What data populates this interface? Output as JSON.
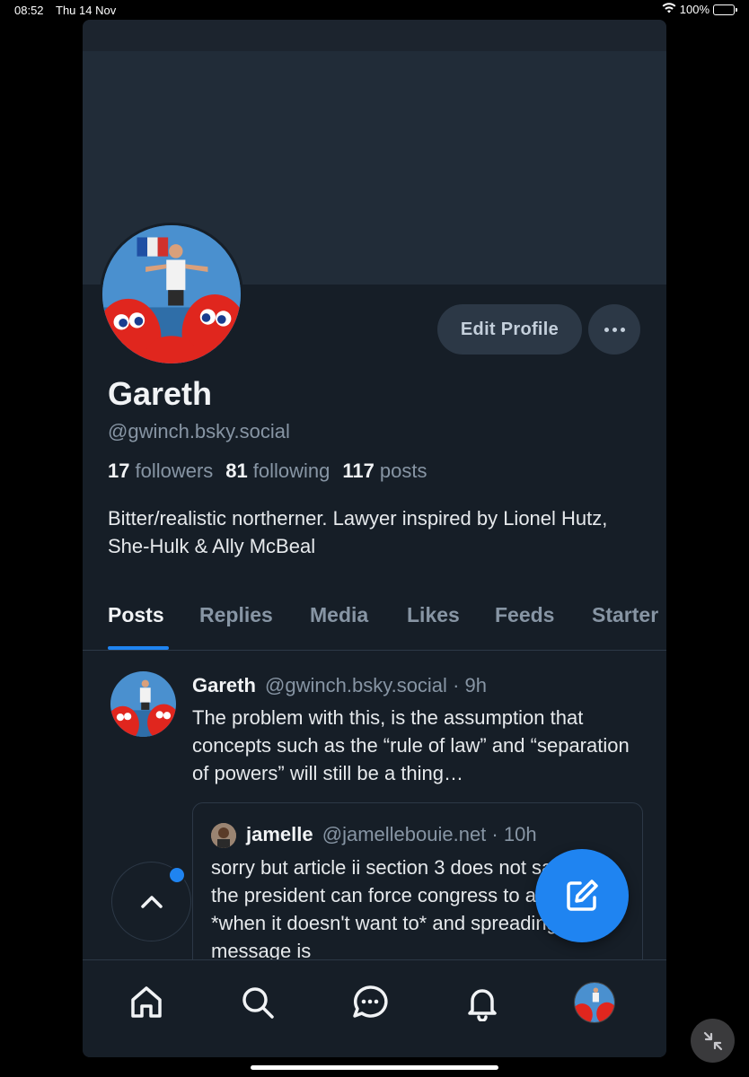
{
  "status_bar": {
    "time": "08:52",
    "date": "Thu 14 Nov",
    "battery": "100%",
    "icons": [
      "wifi-icon",
      "battery-charging-icon"
    ]
  },
  "profile": {
    "display_name": "Gareth",
    "handle": "@gwinch.bsky.social",
    "followers_count": "17",
    "followers_label": "followers",
    "following_count": "81",
    "following_label": "following",
    "posts_count": "117",
    "posts_label": "posts",
    "bio": "Bitter/realistic northerner. Lawyer inspired by Lionel Hutz, She-Hulk & Ally McBeal",
    "edit_button": "Edit Profile",
    "more_icon": "ellipsis-icon"
  },
  "tabs": [
    {
      "label": "Posts",
      "active": true
    },
    {
      "label": "Replies",
      "active": false
    },
    {
      "label": "Media",
      "active": false
    },
    {
      "label": "Likes",
      "active": false
    },
    {
      "label": "Feeds",
      "active": false
    },
    {
      "label": "Starter",
      "active": false
    }
  ],
  "feed": {
    "post": {
      "author": "Gareth",
      "handle": "@gwinch.bsky.social",
      "time": "· 9h",
      "text": "The problem with this, is the assumption that concepts such as the “rule of law” and “separation of powers” will still be a thing…",
      "quote": {
        "author": "jamelle",
        "handle": "@jamellebouie.net",
        "time": "· 10h",
        "text": "sorry but article ii section 3 does not say that the president can force congress to adjourn *when it doesn't want to* and spreading that message is"
      }
    }
  },
  "bottom_nav": [
    "home-icon",
    "search-icon",
    "chat-icon",
    "notifications-bell-icon",
    "profile-avatar"
  ],
  "colors": {
    "accent": "#1f84f1",
    "background": "#161e27",
    "banner": "#212c38",
    "muted_text": "#8795a4"
  }
}
